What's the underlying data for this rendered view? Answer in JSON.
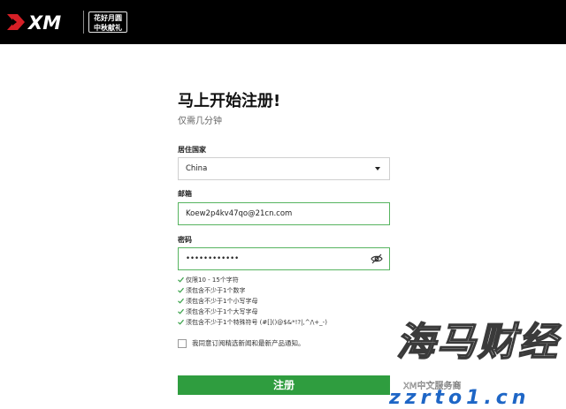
{
  "brand": {
    "logo_text": "XM",
    "promo_line1": "花好月圆",
    "promo_line2": "中秋献礼",
    "colors": {
      "header_bg": "#000000",
      "logo_red": "#d51f26",
      "accent_green": "#2f9d3f",
      "valid_border": "#57b460"
    }
  },
  "form": {
    "title": "马上开始注册!",
    "subtitle": "仅需几分钟",
    "country": {
      "label": "居住国家",
      "value": "China",
      "icon": "chevron-down-icon"
    },
    "email": {
      "label": "邮箱",
      "value": "Koew2p4kv47qo@21cn.com"
    },
    "password": {
      "label": "密码",
      "value": "••••••••••••",
      "icon": "eye-slash-icon"
    },
    "rules": [
      "仅限10 - 15个字符",
      "须包含不少于1个数字",
      "须包含不少于1个小写字母",
      "须包含不少于1个大写字母",
      "须包含不少于1个特殊符号 (#[]()@$&*!?|,^/\\+_-)"
    ],
    "consent_label": "我同意订阅精选新闻和最新产品通知。",
    "submit_label": "注册"
  },
  "watermark": {
    "main": "海马财经",
    "channel": "XM中文服务商",
    "url": "zzrto1.cn"
  }
}
